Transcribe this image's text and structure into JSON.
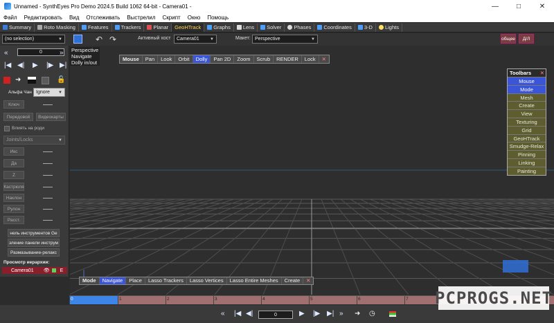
{
  "window": {
    "title": "Unnamed - SynthEyes Pro Demo 2024.5 Build 1062 64-bit - Camera01 -"
  },
  "menu": [
    "Файл",
    "Редактировать",
    "Вид",
    "Отслеживать",
    "Выстрелил",
    "Скрипт",
    "Окно",
    "Помощь"
  ],
  "tabs": [
    {
      "label": "Summary",
      "icon": "summary-icon",
      "color": "#3a7be0"
    },
    {
      "label": "Roto Masking",
      "icon": "roto-icon",
      "color": "#aaaaaa"
    },
    {
      "label": "Features",
      "icon": "features-icon",
      "color": "#4aa0ff"
    },
    {
      "label": "Trackers",
      "icon": "trackers-icon",
      "color": "#4aa0ff"
    },
    {
      "label": "Planar",
      "icon": "planar-icon",
      "color": "#e05050"
    },
    {
      "label": "GeoHTrack",
      "icon": "geohtrack-icon",
      "color": "#ffd75a"
    },
    {
      "label": "Graphs",
      "icon": "graphs-icon",
      "color": "#4aa0ff"
    },
    {
      "label": "Lens",
      "icon": "lens-icon",
      "color": "#dddddd"
    },
    {
      "label": "Solver",
      "icon": "solver-icon",
      "color": "#4aa0ff"
    },
    {
      "label": "Phases",
      "icon": "phases-icon",
      "color": "#dddddd"
    },
    {
      "label": "Coordinates",
      "icon": "coordinates-icon",
      "color": "#4aa0ff"
    },
    {
      "label": "3-D",
      "icon": "3d-icon",
      "color": "#4aa0ff"
    },
    {
      "label": "Lights",
      "icon": "lights-icon",
      "color": "#ffe060"
    }
  ],
  "toolbar": {
    "selection_value": "(no selection)",
    "active_host_label": "Активный хост",
    "active_host_value": "Camera01",
    "layout_label": "Макет:",
    "layout_value": "Perspective",
    "btn_general": "общее",
    "btn_dl": "Д/Л"
  },
  "left_panel": {
    "frame_value": "0",
    "alpha_label": "Альфа Чан",
    "alpha_value": "Ignore",
    "key_btn": "Ключ",
    "front_btn": "Передовой",
    "video_btn": "Видеокарты",
    "affect_label": "Влиять на роди",
    "joints_value": "Joints/Locks",
    "params": [
      "Икс",
      "Да",
      "Z",
      "Кастрюля",
      "Наклон",
      "Рулон",
      "Расст."
    ],
    "cmd_buttons": [
      "нель инструментов Ge",
      "зление панели инструм",
      "Размазывание-релакс"
    ],
    "hierarchy_label": "Просмотр иерархии:",
    "hierarchy_item": "Camera01",
    "hierarchy_flag": "E"
  },
  "viewport": {
    "info_lines": [
      "Perspective",
      "Navigate",
      "Dolly in/out"
    ],
    "mouse_bar": {
      "head": "Mouse",
      "items": [
        "Pan",
        "Look",
        "Orbit",
        "Dolly",
        "Pan 2D",
        "Zoom",
        "Scrub",
        "RENDER",
        "Lock"
      ],
      "active": "Dolly"
    },
    "mode_bar": {
      "head": "Mode",
      "items": [
        "Navigate",
        "Place",
        "Lasso Trackers",
        "Lasso Vertices",
        "Lasso Entire Meshes",
        "Create"
      ],
      "active": "Navigate"
    },
    "toolbars_panel": {
      "title": "Toolbars",
      "items": [
        "Mouse",
        "Mode",
        "Mesh",
        "Create",
        "View",
        "Texturing",
        "Grid",
        "GeoHTrack",
        "Smudge-Relax",
        "Pinning",
        "Linking",
        "Painting"
      ],
      "active": [
        "Mouse",
        "Mode"
      ]
    }
  },
  "timeline": {
    "ticks": [
      "1",
      "2",
      "3",
      "4",
      "5",
      "6",
      "7"
    ],
    "current_frame_label": "0"
  },
  "bottom": {
    "frame_value": "0"
  },
  "watermark": "PCPROGS.NET"
}
